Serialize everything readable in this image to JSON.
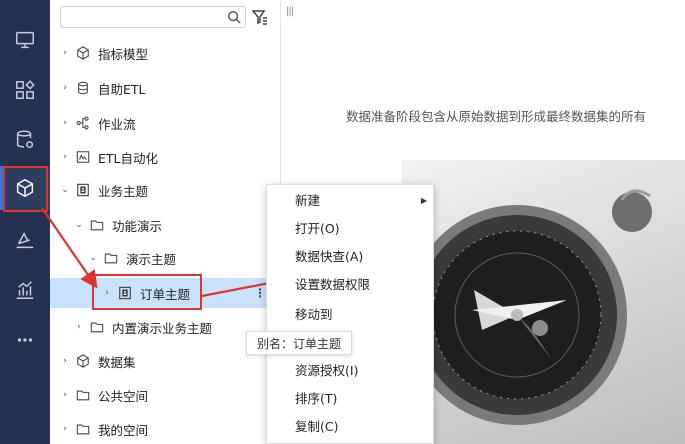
{
  "search": {
    "placeholder": ""
  },
  "tree": {
    "items": [
      {
        "label": "指标模型",
        "icon": "cube-outline-icon"
      },
      {
        "label": "自助ETL",
        "icon": "database-icon"
      },
      {
        "label": "作业流",
        "icon": "workflow-icon"
      },
      {
        "label": "ETL自动化",
        "icon": "etl-automation-icon"
      },
      {
        "label": "业务主题",
        "icon": "business-theme-icon"
      },
      {
        "label": "功能演示",
        "icon": "folder-icon"
      },
      {
        "label": "演示主题",
        "icon": "folder-icon"
      },
      {
        "label": "订单主题",
        "icon": "business-theme-icon"
      },
      {
        "label": "内置演示业务主题",
        "icon": "folder-icon"
      },
      {
        "label": "数据集",
        "icon": "dataset-icon"
      },
      {
        "label": "公共空间",
        "icon": "folder-icon"
      },
      {
        "label": "我的空间",
        "icon": "folder-icon"
      }
    ],
    "more": "⋮"
  },
  "tooltip": {
    "text": "别名：订单主题"
  },
  "context_menu": {
    "items": [
      {
        "label": "新建",
        "has_submenu": true
      },
      {
        "label": "打开(O)"
      },
      {
        "label": "数据快查(A)"
      },
      {
        "label": "设置数据权限"
      },
      {
        "label": "移动到"
      },
      {
        "label": ""
      },
      {
        "label": "资源授权(I)"
      },
      {
        "label": "排序(T)"
      },
      {
        "label": "复制(C)"
      }
    ]
  },
  "content": {
    "grip": "|||",
    "description": "数据准备阶段包含从原始数据到形成最终数据集的所有"
  },
  "colors": {
    "rail_bg": "#24324f",
    "selected_row": "#c9e2fb",
    "highlight_red": "#e2322e"
  }
}
